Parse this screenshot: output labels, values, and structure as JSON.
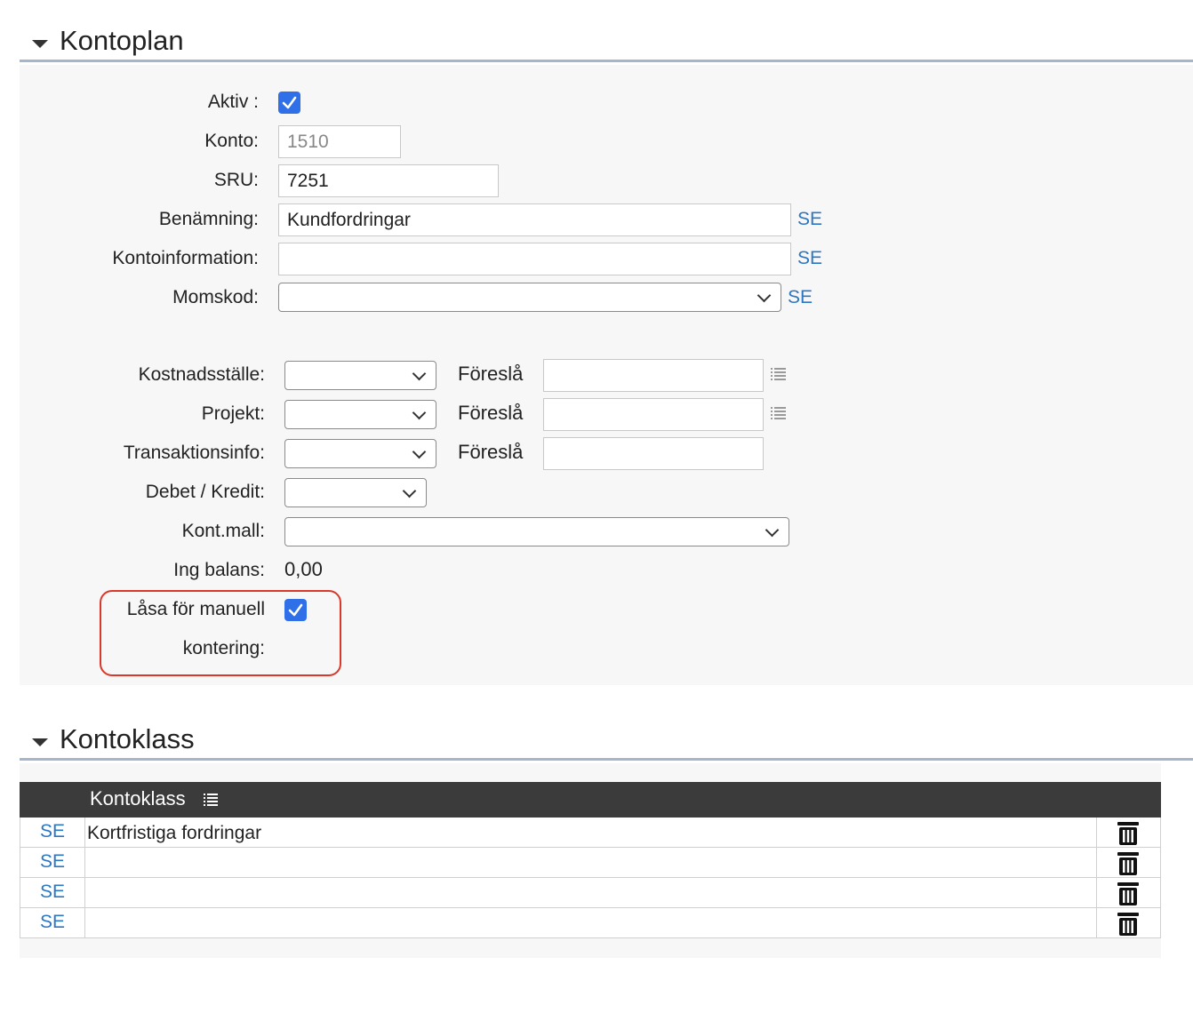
{
  "kontoplan": {
    "title": "Kontoplan",
    "aktiv_label": "Aktiv :",
    "aktiv_checked": true,
    "konto_label": "Konto:",
    "konto_value": "1510",
    "sru_label": "SRU:",
    "sru_value": "7251",
    "benamning_label": "Benämning:",
    "benamning_value": "Kundfordringar",
    "kontoinformation_label": "Kontoinformation:",
    "kontoinformation_value": "",
    "momskod_label": "Momskod:",
    "momskod_value": "",
    "lang_link": "SE",
    "kostnadsstalle_label": "Kostnadsställe:",
    "projekt_label": "Projekt:",
    "transaktionsinfo_label": "Transaktionsinfo:",
    "foresla_label": "Föreslå",
    "debet_kredit_label": "Debet / Kredit:",
    "kontmall_label": "Kont.mall:",
    "ing_balans_label": "Ing balans:",
    "ing_balans_value": "0,00",
    "lasa_label_line1": "Låsa för manuell",
    "lasa_label_line2": "kontering:",
    "lasa_checked": true
  },
  "kontoklass": {
    "title": "Kontoklass",
    "column_header": "Kontoklass",
    "rows": [
      {
        "lang": "SE",
        "value": "Kortfristiga fordringar"
      },
      {
        "lang": "SE",
        "value": ""
      },
      {
        "lang": "SE",
        "value": ""
      },
      {
        "lang": "SE",
        "value": ""
      }
    ]
  },
  "icons": {
    "collapse": "caret-down-icon",
    "list": "list-icon",
    "delete": "trash-icon",
    "check": "checkmark-icon"
  },
  "colors": {
    "accent_link": "#2c77c3",
    "checkbox": "#2f6fe8",
    "highlight_box": "#d9382b",
    "section_rule": "#a5b6cb",
    "table_header": "#3b3b3b"
  }
}
